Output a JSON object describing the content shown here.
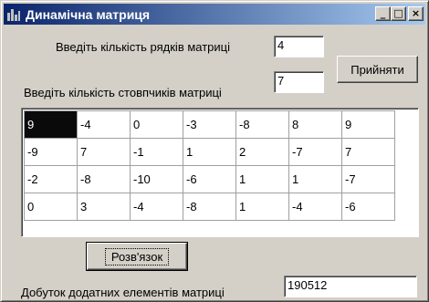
{
  "window": {
    "title": "Динамічна матриця",
    "controls": {
      "minimize": "_",
      "maximize": "□",
      "close": "×"
    }
  },
  "form": {
    "rows_label": "Введіть кількість рядків матриці",
    "rows_value": "4",
    "cols_label": "Введіть кількість стовпчиків матриці",
    "cols_value": "7",
    "accept_button": "Прийняти",
    "solve_button": "Розв'язок",
    "result_label": "Добуток додатних елементів матриці",
    "result_value": "190512"
  },
  "matrix": {
    "rows": [
      [
        "9",
        "-4",
        "0",
        "-3",
        "-8",
        "8",
        "9"
      ],
      [
        "-9",
        "7",
        "-1",
        "1",
        "2",
        "-7",
        "7"
      ],
      [
        "-2",
        "-8",
        "-10",
        "-6",
        "1",
        "1",
        "-7"
      ],
      [
        "0",
        "3",
        "-4",
        "-8",
        "1",
        "-4",
        "-6"
      ]
    ]
  },
  "icons": {
    "app": "app-icon"
  }
}
